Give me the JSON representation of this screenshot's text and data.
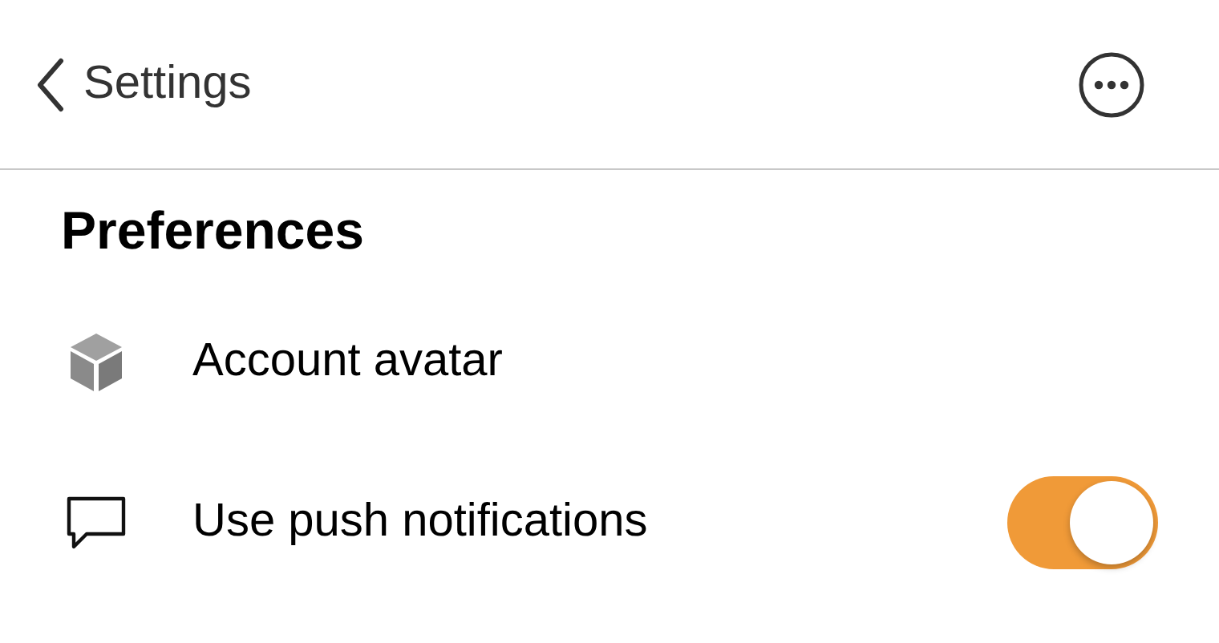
{
  "nav": {
    "back_label": "Settings"
  },
  "section": {
    "title": "Preferences"
  },
  "items": [
    {
      "kind": "link",
      "label": "Account avatar"
    },
    {
      "kind": "toggle",
      "label": "Use push notifications",
      "on": true
    }
  ]
}
